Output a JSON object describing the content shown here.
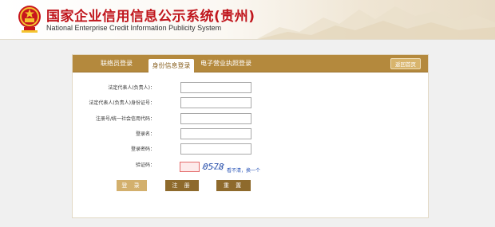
{
  "header": {
    "title": "国家企业信用信息公示系统(贵州)",
    "subtitle": "National Enterprise Credit Information Publicity System"
  },
  "tabs": [
    {
      "label": "联络员登录",
      "active": false
    },
    {
      "label": "身份信息登录",
      "active": true
    },
    {
      "label": "电子营业执照登录",
      "active": false
    }
  ],
  "back_button": "返回首页",
  "form": {
    "fields": [
      {
        "label": "法定代表人(负责人)：",
        "value": ""
      },
      {
        "label": "法定代表人(负责人)身份证号：",
        "value": ""
      },
      {
        "label": "注册号/统一社会信用代码：",
        "value": ""
      },
      {
        "label": "登录名：",
        "value": ""
      },
      {
        "label": "登录密码：",
        "value": ""
      }
    ],
    "captcha": {
      "label": "验证码：",
      "value": "",
      "image_text": "0578",
      "refresh_text": "看不清，换一个"
    }
  },
  "buttons": {
    "login": "登 录",
    "register": "注 册",
    "reset": "重 置"
  },
  "colors": {
    "title_red": "#c0161d",
    "tabbar_gold": "#b4893d",
    "button_dark": "#8e6a2c",
    "button_light": "#d3b06d"
  }
}
